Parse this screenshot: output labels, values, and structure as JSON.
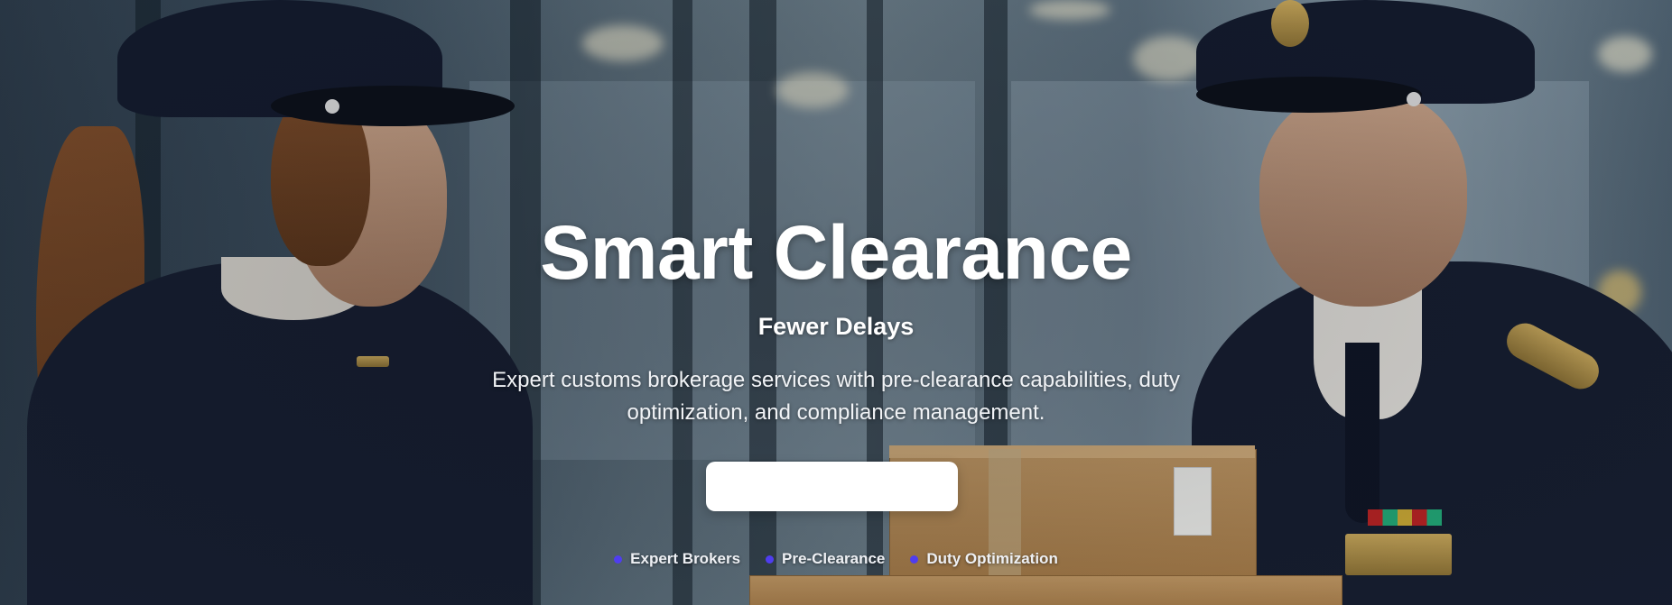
{
  "hero": {
    "title": "Smart Clearance",
    "subtitle": "Fewer Delays",
    "description": "Expert customs brokerage services with pre-clearance capabilities, duty optimization, and compliance management.",
    "cta_label": "",
    "features": [
      {
        "label": "Expert Brokers",
        "icon": "bullet-dot-icon"
      },
      {
        "label": "Pre-Clearance",
        "icon": "bullet-dot-icon"
      },
      {
        "label": "Duty Optimization",
        "icon": "bullet-dot-icon"
      }
    ]
  },
  "colors": {
    "accent": "#4f3df0",
    "text": "#ffffff",
    "cta_background": "#ffffff"
  }
}
